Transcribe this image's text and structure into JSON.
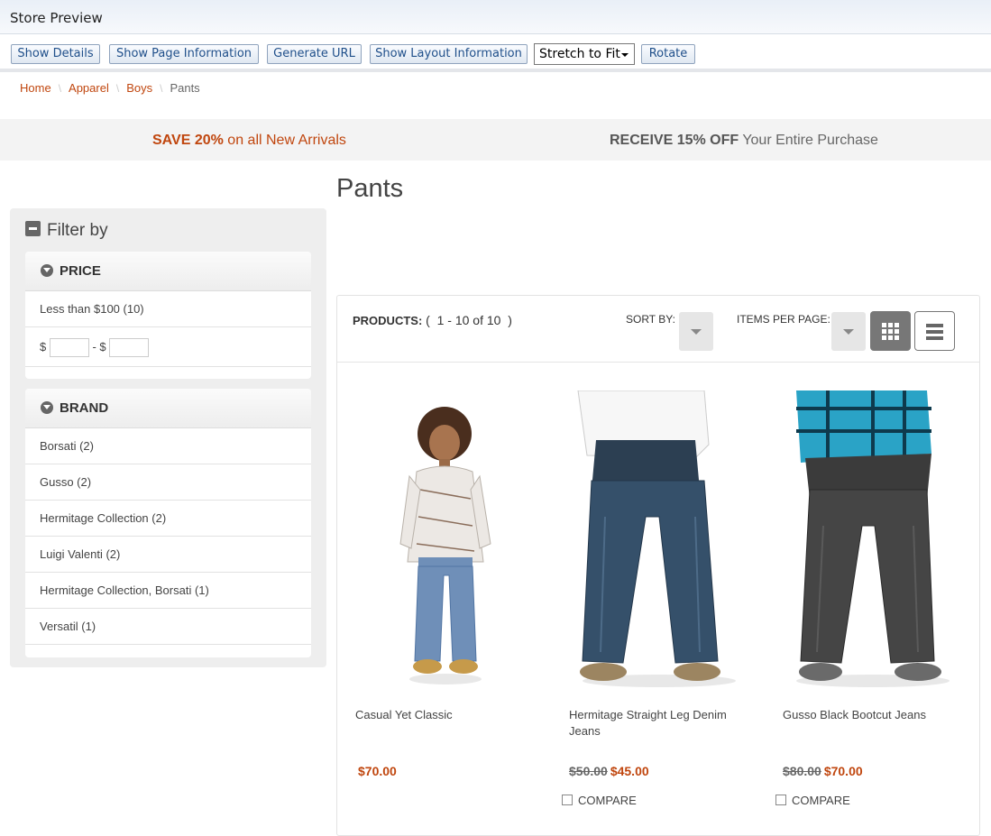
{
  "window": {
    "title": "Store Preview"
  },
  "toolbar": {
    "buttons": [
      "Show Details",
      "Show Page Information",
      "Generate URL",
      "Show Layout Information"
    ],
    "zoom_select": "Stretch to Fit",
    "rotate": "Rotate"
  },
  "breadcrumb": {
    "items": [
      "Home",
      "Apparel",
      "Boys"
    ],
    "current": "Pants",
    "separator": "\\"
  },
  "promo": {
    "left_strong": "SAVE 20%",
    "left_rest": " on all New Arrivals",
    "right_strong": "RECEIVE 15% OFF",
    "right_rest": " Your Entire Purchase"
  },
  "page_title": "Pants",
  "filter": {
    "title": "Filter by",
    "price": {
      "heading": "PRICE",
      "option": "Less than $100 (10)",
      "currency": "$",
      "range_sep": "- $",
      "min_value": "",
      "max_value": ""
    },
    "brand": {
      "heading": "BRAND",
      "options": [
        "Borsati (2)",
        "Gusso (2)",
        "Hermitage Collection (2)",
        "Luigi Valenti (2)",
        "Hermitage Collection, Borsati (1)",
        "Versatil (1)"
      ]
    }
  },
  "listing": {
    "products_label": "PRODUCTS:",
    "range_text": "(  1 - 10 of 10  )",
    "sort_label": "SORT BY:",
    "per_page_label": "ITEMS PER PAGE:",
    "view_mode": "grid"
  },
  "products": [
    {
      "name": "Casual Yet Classic",
      "old_price": "",
      "price": "$70.00",
      "compare": ""
    },
    {
      "name": "Hermitage Straight Leg Denim Jeans",
      "old_price": "$50.00",
      "price": "$45.00",
      "compare": "COMPARE"
    },
    {
      "name": "Gusso Black Bootcut Jeans",
      "old_price": "$80.00",
      "price": "$70.00",
      "compare": "COMPARE"
    }
  ],
  "colors": {
    "accent": "#c0460e",
    "promo_bg": "#f3f3f3",
    "sidebar_bg": "#eeeeee"
  }
}
